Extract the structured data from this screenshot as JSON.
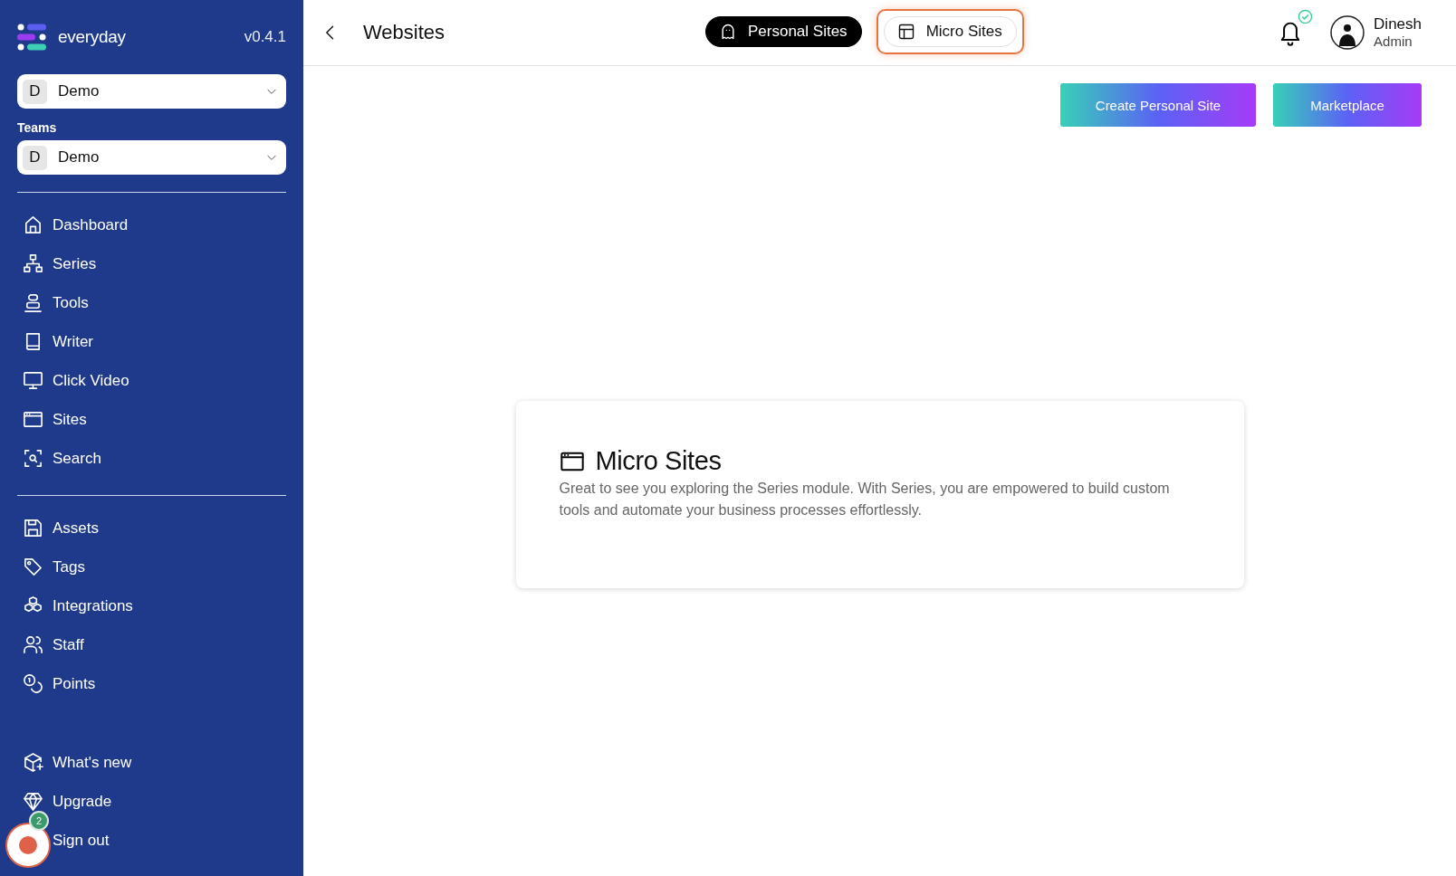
{
  "sidebar": {
    "brand": "everyday",
    "version": "v0.4.1",
    "workspace": {
      "initial": "D",
      "name": "Demo"
    },
    "teams_label": "Teams",
    "team": {
      "initial": "D",
      "name": "Demo"
    },
    "nav_groups": [
      {
        "items": [
          {
            "label": "Dashboard"
          },
          {
            "label": "Series"
          },
          {
            "label": "Tools"
          },
          {
            "label": "Writer"
          },
          {
            "label": "Click Video"
          },
          {
            "label": "Sites"
          },
          {
            "label": "Search"
          }
        ]
      },
      {
        "items": [
          {
            "label": "Assets"
          },
          {
            "label": "Tags"
          },
          {
            "label": "Integrations"
          },
          {
            "label": "Staff"
          },
          {
            "label": "Points"
          }
        ]
      },
      {
        "items": [
          {
            "label": "What's new"
          },
          {
            "label": "Upgrade"
          },
          {
            "label": "Sign out"
          }
        ]
      }
    ]
  },
  "recorder": {
    "badge": "2"
  },
  "header": {
    "title": "Websites",
    "tabs": [
      {
        "label": "Personal Sites",
        "selected": true,
        "highlighted": false
      },
      {
        "label": "Micro Sites",
        "selected": false,
        "highlighted": true
      }
    ],
    "notifications": {
      "all_read": true
    },
    "user": {
      "name": "Dinesh",
      "role": "Admin"
    }
  },
  "actions": [
    "Create Personal Site",
    "Marketplace"
  ],
  "card": {
    "title": "Micro Sites",
    "text": "Great to see you exploring the Series module. With Series, you are empowered to build custom tools and automate your business processes effortlessly."
  }
}
